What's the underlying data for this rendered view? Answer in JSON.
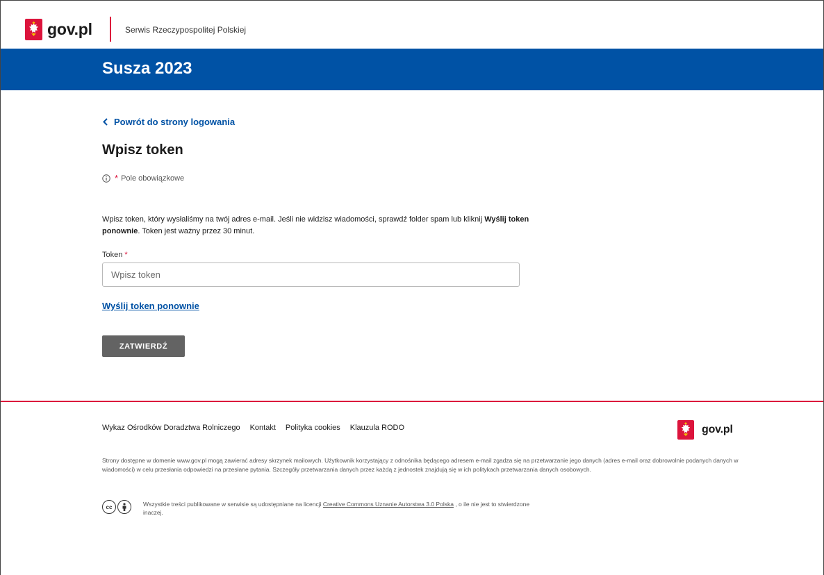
{
  "header": {
    "logo_text": "gov.pl",
    "service_name": "Serwis Rzeczypospolitej Polskiej"
  },
  "banner": {
    "title": "Susza 2023"
  },
  "main": {
    "back_link": "Powrót do strony logowania",
    "heading": "Wpisz token",
    "required_star": "*",
    "required_note": "Pole obowiązkowe",
    "description_part1": "Wpisz token, który wysłaliśmy na twój adres e-mail. Jeśli nie widzisz wiadomości, sprawdź folder spam lub kliknij ",
    "description_bold": "Wyślij token ponownie",
    "description_part2": ". Token jest ważny przez 30 minut.",
    "token_label": "Token",
    "token_star": "*",
    "token_placeholder": "Wpisz token",
    "token_value": "",
    "resend_link": "Wyślij token ponownie",
    "submit_label": "ZATWIERDŹ"
  },
  "footer": {
    "links": [
      "Wykaz Ośrodków Doradztwa Rolniczego",
      "Kontakt",
      "Polityka cookies",
      "Klauzula RODO"
    ],
    "logo_text": "gov.pl",
    "disclaimer": "Strony dostępne w domenie www.gov.pl mogą zawierać adresy skrzynek mailowych. Użytkownik korzystający z odnośnika będącego adresem e-mail zgadza się na przetwarzanie jego danych (adres e-mail oraz dobrowolnie podanych danych w wiadomości) w celu przesłania odpowiedzi na przesłane pytania. Szczegóły przetwarzania danych przez każdą z jednostek znajdują się w ich politykach przetwarzania danych osobowych.",
    "license_part1": "Wszystkie treści publikowane w serwisie są udostępniane na licencji ",
    "license_link": "Creative Commons Uznanie Autorstwa 3.0 Polska",
    "license_part2": " , o ile nie jest to stwierdzone inaczej.",
    "cc_badge": "cc"
  },
  "colors": {
    "brand_blue": "#0052a5",
    "accent_red": "#dc143c",
    "button_grey": "#636363"
  },
  "icons": {
    "emblem": "polish-eagle-emblem-icon",
    "back": "chevron-left-icon",
    "info": "info-circle-icon",
    "cc": "creative-commons-icon",
    "by": "attribution-person-icon"
  }
}
